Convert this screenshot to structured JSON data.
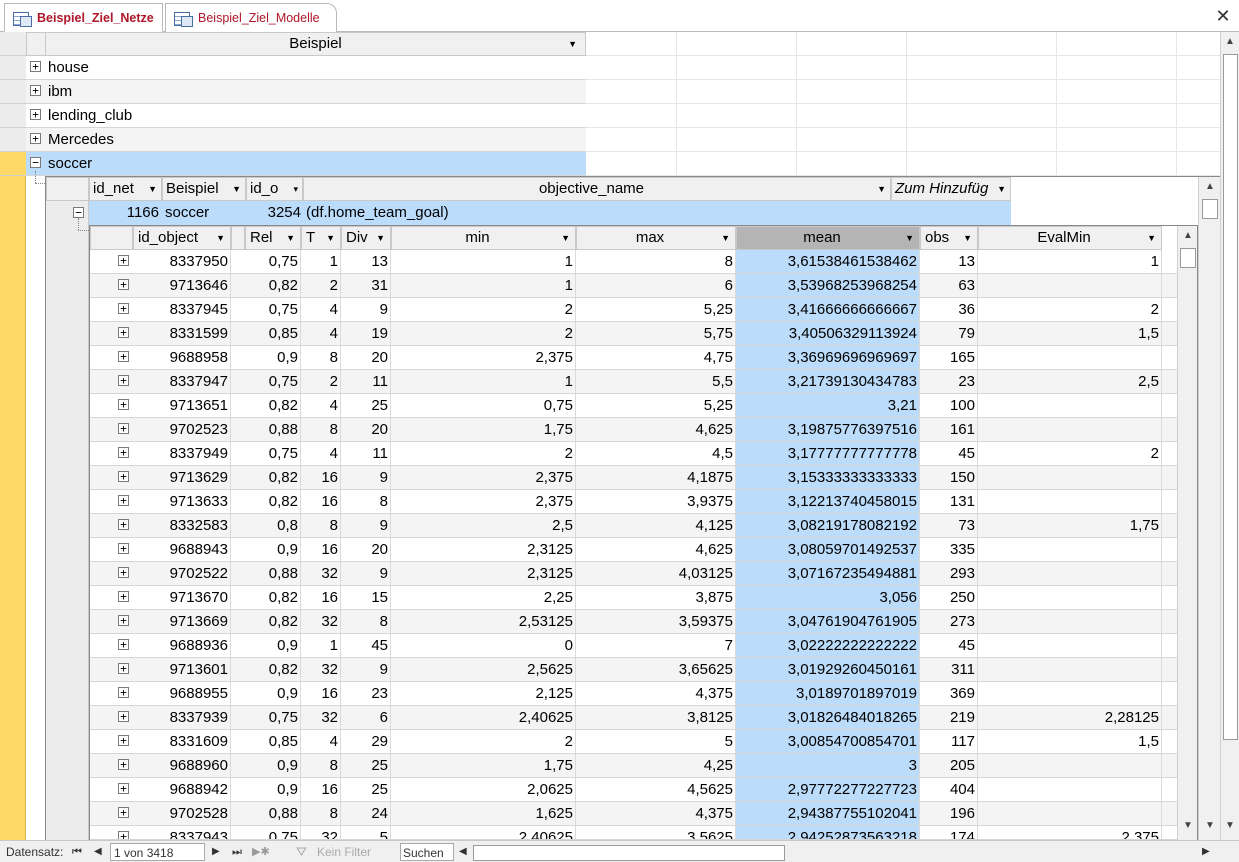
{
  "tabs": [
    {
      "label": "Beispiel_Ziel_Netze",
      "active": true
    },
    {
      "label": "Beispiel_Ziel_Modelle",
      "active": false
    }
  ],
  "close_glyph": "✕",
  "outer": {
    "header": "Beispiel",
    "rows": [
      {
        "label": "house",
        "expander": "+"
      },
      {
        "label": "ibm",
        "expander": "+"
      },
      {
        "label": "lending_club",
        "expander": "+"
      },
      {
        "label": "Mercedes",
        "expander": "+"
      },
      {
        "label": "soccer",
        "expander": "−"
      }
    ]
  },
  "mid": {
    "headers": [
      "id_net",
      "Beispiel",
      "id_o",
      "objective_name",
      "Zum Hinzufüg"
    ],
    "row": {
      "id_net": "1166",
      "beispiel": "soccer",
      "id_o": "3254",
      "objective_name": "(df.home_team_goal)",
      "expander": "−"
    }
  },
  "inner": {
    "headers": [
      "id_object",
      "Rel",
      "T",
      "Div",
      "min",
      "max",
      "mean",
      "obs",
      "EvalMin"
    ],
    "rows": [
      [
        "8337950",
        "0,75",
        "1",
        "13",
        "1",
        "8",
        "3,61538461538462",
        "13",
        "1"
      ],
      [
        "9713646",
        "0,82",
        "2",
        "31",
        "1",
        "6",
        "3,53968253968254",
        "63",
        ""
      ],
      [
        "8337945",
        "0,75",
        "4",
        "9",
        "2",
        "5,25",
        "3,41666666666667",
        "36",
        "2"
      ],
      [
        "8331599",
        "0,85",
        "4",
        "19",
        "2",
        "5,75",
        "3,40506329113924",
        "79",
        "1,5"
      ],
      [
        "9688958",
        "0,9",
        "8",
        "20",
        "2,375",
        "4,75",
        "3,36969696969697",
        "165",
        ""
      ],
      [
        "8337947",
        "0,75",
        "2",
        "11",
        "1",
        "5,5",
        "3,21739130434783",
        "23",
        "2,5"
      ],
      [
        "9713651",
        "0,82",
        "4",
        "25",
        "0,75",
        "5,25",
        "3,21",
        "100",
        ""
      ],
      [
        "9702523",
        "0,88",
        "8",
        "20",
        "1,75",
        "4,625",
        "3,19875776397516",
        "161",
        ""
      ],
      [
        "8337949",
        "0,75",
        "4",
        "11",
        "2",
        "4,5",
        "3,17777777777778",
        "45",
        "2"
      ],
      [
        "9713629",
        "0,82",
        "16",
        "9",
        "2,375",
        "4,1875",
        "3,15333333333333",
        "150",
        ""
      ],
      [
        "9713633",
        "0,82",
        "16",
        "8",
        "2,375",
        "3,9375",
        "3,12213740458015",
        "131",
        ""
      ],
      [
        "8332583",
        "0,8",
        "8",
        "9",
        "2,5",
        "4,125",
        "3,08219178082192",
        "73",
        "1,75"
      ],
      [
        "9688943",
        "0,9",
        "16",
        "20",
        "2,3125",
        "4,625",
        "3,08059701492537",
        "335",
        ""
      ],
      [
        "9702522",
        "0,88",
        "32",
        "9",
        "2,3125",
        "4,03125",
        "3,07167235494881",
        "293",
        ""
      ],
      [
        "9713670",
        "0,82",
        "16",
        "15",
        "2,25",
        "3,875",
        "3,056",
        "250",
        ""
      ],
      [
        "9713669",
        "0,82",
        "32",
        "8",
        "2,53125",
        "3,59375",
        "3,04761904761905",
        "273",
        ""
      ],
      [
        "9688936",
        "0,9",
        "1",
        "45",
        "0",
        "7",
        "3,02222222222222",
        "45",
        ""
      ],
      [
        "9713601",
        "0,82",
        "32",
        "9",
        "2,5625",
        "3,65625",
        "3,01929260450161",
        "311",
        ""
      ],
      [
        "9688955",
        "0,9",
        "16",
        "23",
        "2,125",
        "4,375",
        "3,0189701897019",
        "369",
        ""
      ],
      [
        "8337939",
        "0,75",
        "32",
        "6",
        "2,40625",
        "3,8125",
        "3,01826484018265",
        "219",
        "2,28125"
      ],
      [
        "8331609",
        "0,85",
        "4",
        "29",
        "2",
        "5",
        "3,00854700854701",
        "117",
        "1,5"
      ],
      [
        "9688960",
        "0,9",
        "8",
        "25",
        "1,75",
        "4,25",
        "3",
        "205",
        ""
      ],
      [
        "9688942",
        "0,9",
        "16",
        "25",
        "2,0625",
        "4,5625",
        "2,97772277227723",
        "404",
        ""
      ],
      [
        "9702528",
        "0,88",
        "8",
        "24",
        "1,625",
        "4,375",
        "2,94387755102041",
        "196",
        ""
      ],
      [
        "8337943",
        "0,75",
        "32",
        "5",
        "2,40625",
        "3,5625",
        "2,94252873563218",
        "174",
        "2,375"
      ]
    ]
  },
  "statusbar": {
    "label": "Datensatz:",
    "record": "1 von 3418",
    "filter": "Kein Filter",
    "search": "Suchen"
  },
  "colors": {
    "selected": "#bcdcfb",
    "selected_col": "#bcdcfb",
    "yellow": "#ffd966",
    "tab_text": "#b0162a"
  }
}
